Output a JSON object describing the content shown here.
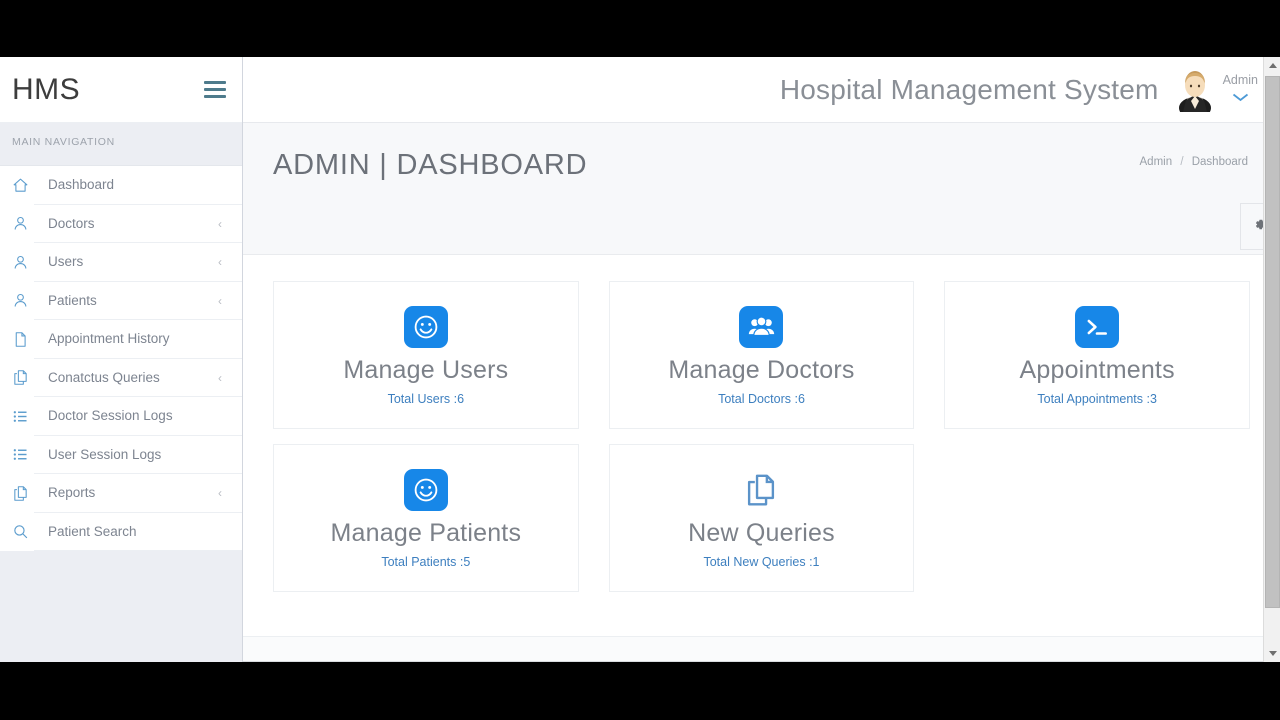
{
  "brand": {
    "logo": "HMS",
    "menu_icon": "hamburger-icon"
  },
  "topbar": {
    "app_title": "Hospital Management System",
    "user_name": "Admin",
    "caret_icon": "chevron-down-icon",
    "avatar_icon": "user-avatar"
  },
  "sidebar": {
    "section_title": "MAIN NAVIGATION",
    "items": [
      {
        "label": "Dashboard",
        "icon": "home-icon",
        "has_arrow": false
      },
      {
        "label": "Doctors",
        "icon": "user-icon",
        "has_arrow": true
      },
      {
        "label": "Users",
        "icon": "user-icon",
        "has_arrow": true
      },
      {
        "label": "Patients",
        "icon": "user-icon",
        "has_arrow": true
      },
      {
        "label": "Appointment History",
        "icon": "file-icon",
        "has_arrow": false
      },
      {
        "label": "Conatctus Queries",
        "icon": "copy-files-icon",
        "has_arrow": true
      },
      {
        "label": "Doctor Session Logs",
        "icon": "list-icon",
        "has_arrow": false
      },
      {
        "label": "User Session Logs",
        "icon": "list-icon",
        "has_arrow": false
      },
      {
        "label": "Reports",
        "icon": "copy-files-icon",
        "has_arrow": true
      },
      {
        "label": "Patient Search",
        "icon": "search-icon",
        "has_arrow": false
      }
    ],
    "arrow_glyph": "‹"
  },
  "page": {
    "title": "ADMIN | DASHBOARD",
    "breadcrumb": {
      "root": "Admin",
      "separator": "/",
      "current": "Dashboard"
    },
    "settings_icon": "gear-icon"
  },
  "cards": [
    {
      "title": "Manage Users",
      "sub": "Total Users :6",
      "icon": "smiley-face-icon",
      "badge": true,
      "accent": "#1787e8"
    },
    {
      "title": "Manage Doctors",
      "sub": "Total Doctors :6",
      "icon": "people-group-icon",
      "badge": true,
      "accent": "#1787e8"
    },
    {
      "title": "Appointments",
      "sub": "Total Appointments :3",
      "icon": "terminal-icon",
      "badge": true,
      "accent": "#1787e8"
    },
    {
      "title": "Manage Patients",
      "sub": "Total Patients :5",
      "icon": "smiley-face-icon",
      "badge": true,
      "accent": "#1787e8"
    },
    {
      "title": "New Queries",
      "sub": "Total New Queries :1",
      "icon": "copy-files-icon",
      "badge": false,
      "accent": "#5b93c9"
    }
  ],
  "scrollbar": {
    "up_icon": "scroll-up-arrow",
    "down_icon": "scroll-down-arrow",
    "thumb": "scroll-thumb"
  },
  "colors": {
    "primary_blue": "#1787e8",
    "link_blue": "#3d7fbf",
    "icon_blue": "#5b9ccd",
    "text_gray": "#7c8189"
  }
}
